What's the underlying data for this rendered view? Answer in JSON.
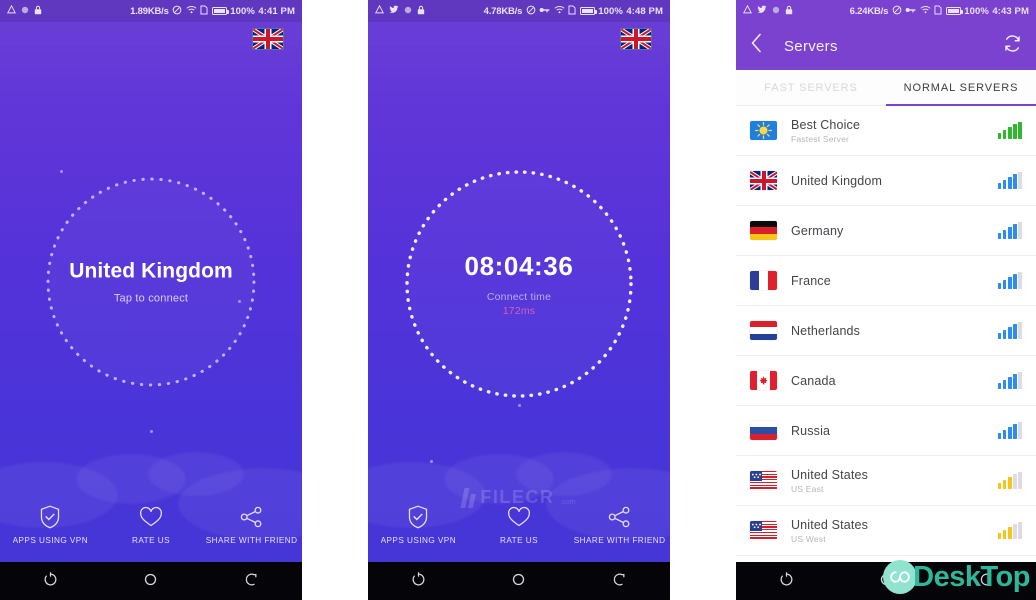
{
  "panels": [
    {
      "id": "connect-screen",
      "statusbar": {
        "icons_left": [
          "warning-triangle-icon",
          "circle-icon",
          "lock-icon"
        ],
        "speed": "1.89KB/s",
        "icons_right": [
          "mute-icon",
          "wifi-icon",
          "sim-icon"
        ],
        "battery": "100%",
        "time": "4:41 PM"
      },
      "flag": "united-kingdom-flag",
      "country": "United Kingdom",
      "hint": "Tap to connect",
      "actions": [
        {
          "icon": "shield-check-icon",
          "label": "APPS USING VPN"
        },
        {
          "icon": "heart-icon",
          "label": "RATE US"
        },
        {
          "icon": "share-icon",
          "label": "SHARE WITH FRIEND"
        }
      ],
      "nav": [
        "recents-icon",
        "home-icon",
        "back-icon"
      ]
    },
    {
      "id": "connected-screen",
      "statusbar": {
        "icons_left": [
          "warning-triangle-icon",
          "twitter-icon",
          "circle-icon",
          "lock-icon"
        ],
        "speed": "4.78KB/s",
        "icons_right": [
          "mute-icon",
          "vpn-key-icon",
          "wifi-icon",
          "sim-icon"
        ],
        "battery": "100%",
        "time": "4:48 PM"
      },
      "flag": "united-kingdom-flag",
      "timer": "08:04:36",
      "connect_label": "Connect time",
      "ping": "172ms",
      "watermark": {
        "name": "FILECR",
        "suffix": ".com"
      },
      "actions": [
        {
          "icon": "shield-check-icon",
          "label": "APPS USING VPN"
        },
        {
          "icon": "heart-icon",
          "label": "RATE US"
        },
        {
          "icon": "share-icon",
          "label": "SHARE WITH FRIEND"
        }
      ],
      "nav": [
        "recents-icon",
        "home-icon",
        "back-icon"
      ]
    },
    {
      "id": "servers-screen",
      "statusbar": {
        "icons_left": [
          "warning-triangle-icon",
          "twitter-icon",
          "circle-icon",
          "lock-icon"
        ],
        "speed": "6.24KB/s",
        "icons_right": [
          "mute-icon",
          "vpn-key-icon",
          "wifi-icon",
          "sim-icon"
        ],
        "battery": "100%",
        "time": "4:43 PM"
      },
      "header": {
        "back_icon": "chevron-left-icon",
        "title": "Servers",
        "refresh_icon": "refresh-icon"
      },
      "tabs": [
        {
          "label": "FAST SERVERS",
          "active": false
        },
        {
          "label": "NORMAL SERVERS",
          "active": true
        }
      ],
      "servers": [
        {
          "name": "Best Choice",
          "sub": "Fastest Server",
          "flag": "best-choice-flag",
          "signal": 5,
          "color": "#2eb82e"
        },
        {
          "name": "United Kingdom",
          "sub": "",
          "flag": "uk-flag",
          "signal": 4,
          "color": "#2d8cf0"
        },
        {
          "name": "Germany",
          "sub": "",
          "flag": "germany-flag",
          "signal": 4,
          "color": "#2d8cf0"
        },
        {
          "name": "France",
          "sub": "",
          "flag": "france-flag",
          "signal": 4,
          "color": "#2d8cf0"
        },
        {
          "name": "Netherlands",
          "sub": "",
          "flag": "netherlands-flag",
          "signal": 4,
          "color": "#2d8cf0"
        },
        {
          "name": "Canada",
          "sub": "",
          "flag": "canada-flag",
          "signal": 4,
          "color": "#2d8cf0"
        },
        {
          "name": "Russia",
          "sub": "",
          "flag": "russia-flag",
          "signal": 4,
          "color": "#2d8cf0"
        },
        {
          "name": "United States",
          "sub": "US East",
          "flag": "usa-flag",
          "signal": 3,
          "color": "#f5c518"
        },
        {
          "name": "United States",
          "sub": "US West",
          "flag": "usa-flag",
          "signal": 3,
          "color": "#f5c518"
        }
      ],
      "nav": [
        "recents-icon",
        "home-icon",
        "back-icon"
      ],
      "watermark": {
        "logo": "infinity-logo",
        "text": "DeskTop"
      }
    }
  ],
  "colors": {
    "purple_top": "#6b3fd6",
    "indigo_bottom": "#4436d6",
    "header_purple": "#7b41cf",
    "accent_pink": "#d45fb5",
    "signal_green": "#2eb82e",
    "signal_blue": "#2d8cf0",
    "signal_yellow": "#f5c518",
    "watermark_teal": "#2fb79a"
  }
}
